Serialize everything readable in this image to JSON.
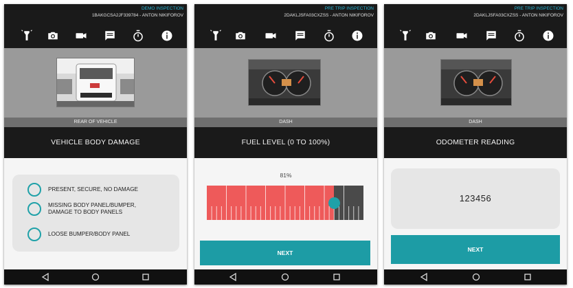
{
  "screens": [
    {
      "header": {
        "inspection_type": "DEMO INSPECTION",
        "vin_user": "1BAKGCSA2JF339784 - ANTON NIKIFOROV"
      },
      "photo_caption": "REAR OF VEHICLE",
      "section_title": "VEHICLE BODY DAMAGE",
      "options": [
        {
          "label": "PRESENT, SECURE, NO DAMAGE"
        },
        {
          "label_line1": "MISSING BODY PANEL/BUMPER,",
          "label_line2": "DAMAGE TO BODY PANELS"
        },
        {
          "label": "LOOSE BUMPER/BODY PANEL"
        }
      ]
    },
    {
      "header": {
        "inspection_type": "PRE TRIP INSPECTION",
        "vin_user": "2DAKLJSFA03CXZSS - ANTON NIKIFOROV"
      },
      "photo_caption": "DASH",
      "section_title": "FUEL LEVEL (0 TO 100%)",
      "fuel_percent_text": "81%",
      "fuel_level": 0.81,
      "next_label": "NEXT"
    },
    {
      "header": {
        "inspection_type": "PRE TRIP INSPECTION",
        "vin_user": "2DAKLJSFA03CXZSS - ANTON NIKIFOROV"
      },
      "photo_caption": "DASH",
      "section_title": "ODOMETER READING",
      "odometer_value": "123456",
      "next_label": "NEXT"
    }
  ],
  "toolbar_icons": [
    "flashlight-icon",
    "camera-icon",
    "video-icon",
    "comment-icon",
    "timer-icon",
    "info-icon"
  ],
  "nav_icons": [
    "back-icon",
    "home-icon",
    "recents-icon"
  ],
  "colors": {
    "accent": "#1d9ca5",
    "fuel_fill": "#ee5a5a",
    "bar_dark": "#1a1a1a",
    "header_text": "#29b6d6"
  }
}
